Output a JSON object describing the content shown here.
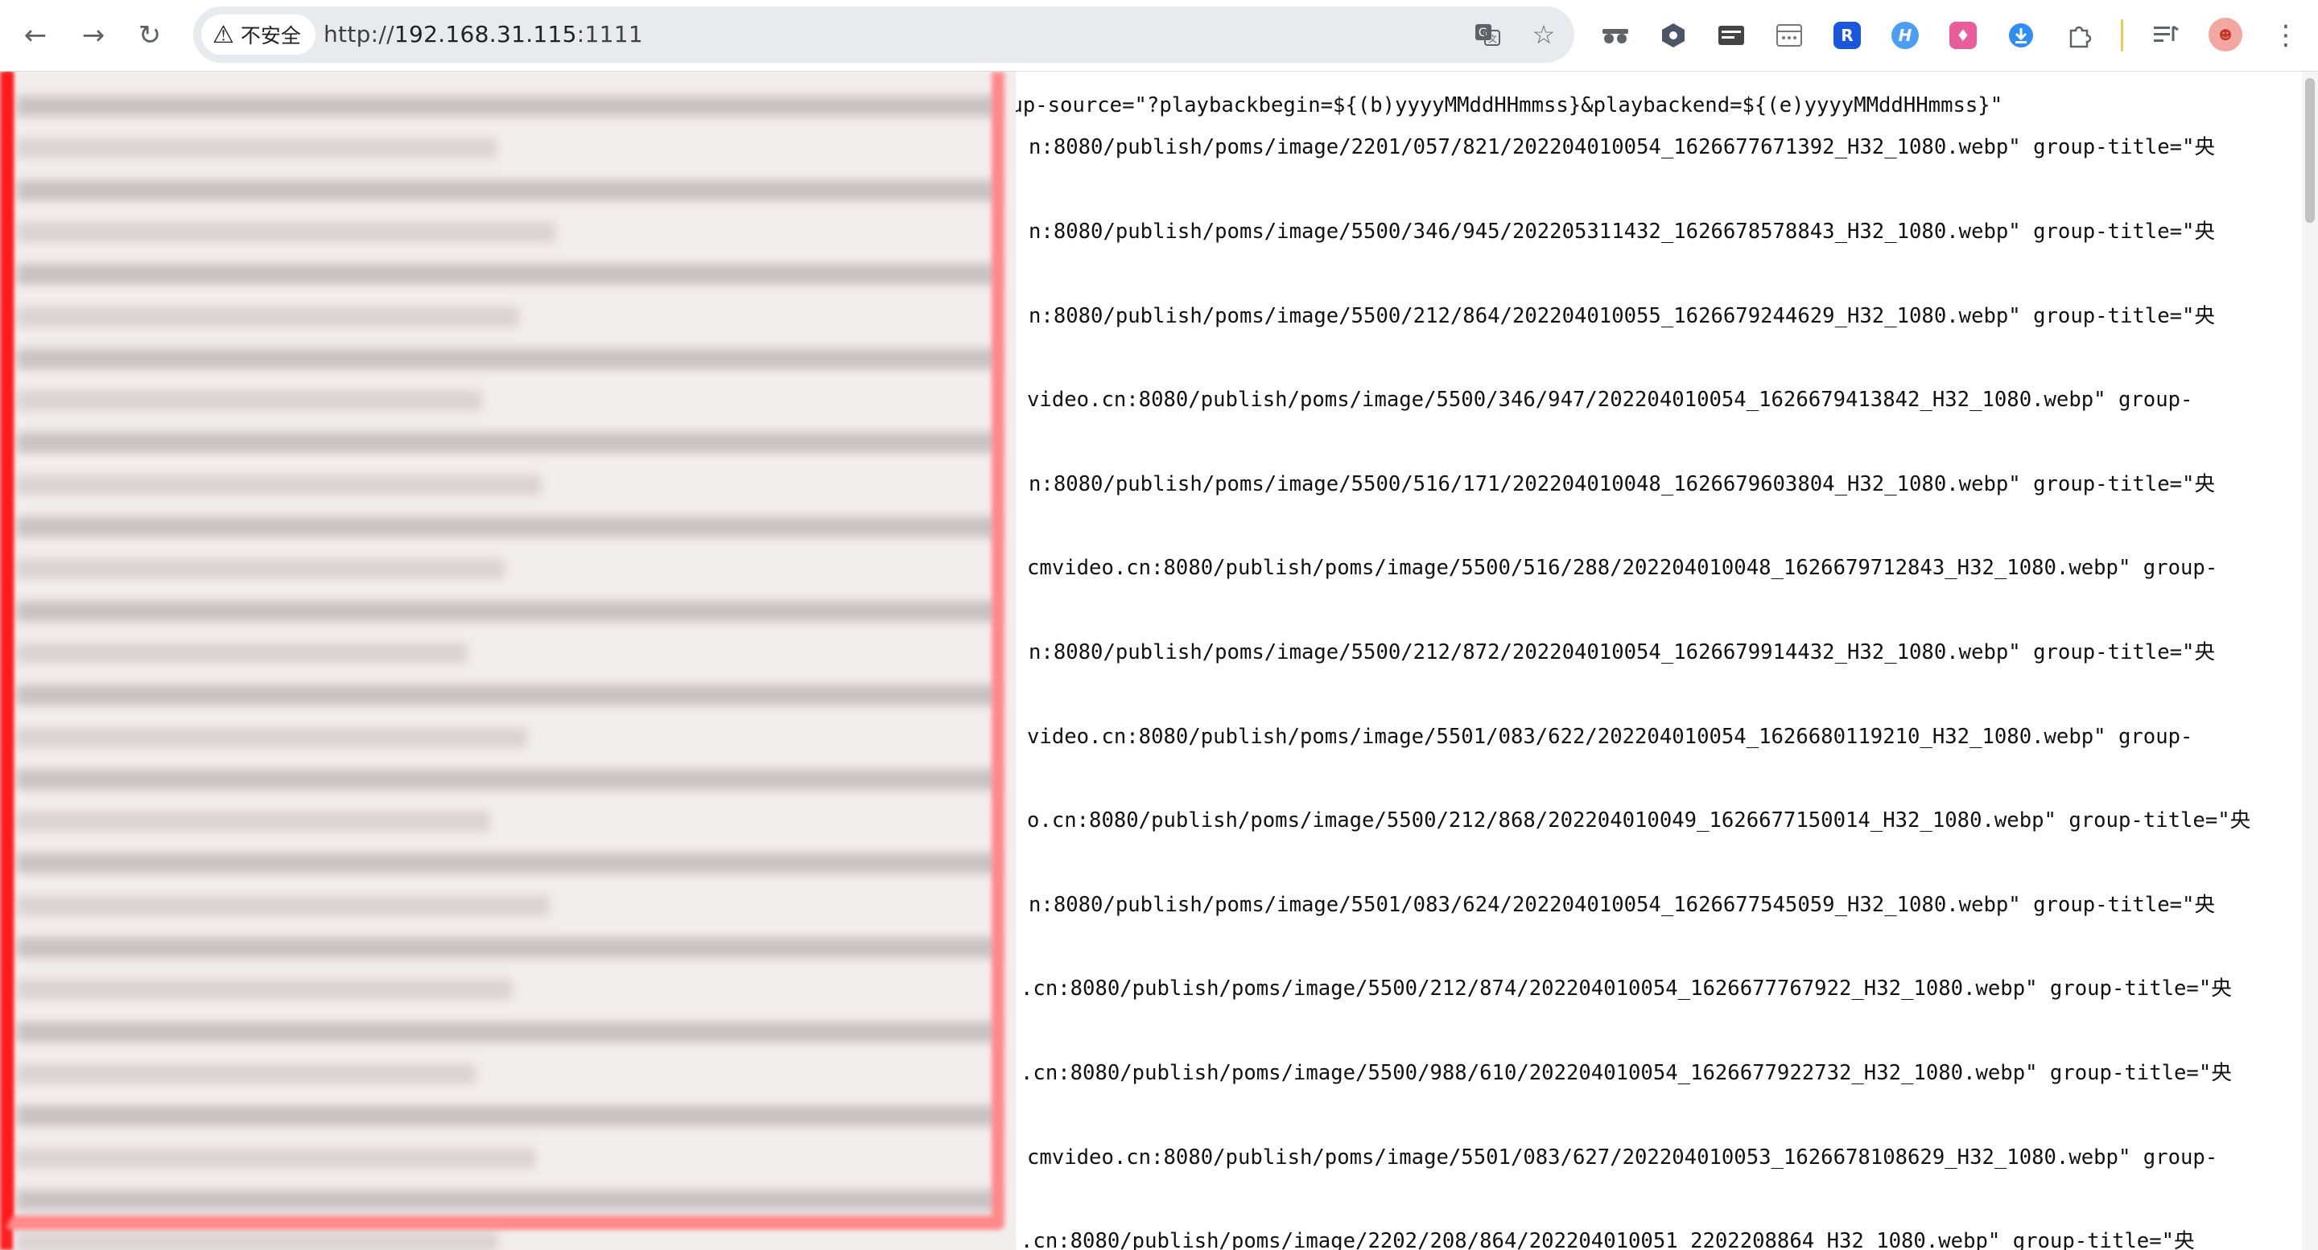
{
  "browser": {
    "security_label": "不安全",
    "url_scheme": "http://",
    "url_host": "192.168.31.115",
    "url_port": ":1111",
    "nav": {
      "back_icon": "back-arrow-icon",
      "forward_icon": "forward-arrow-icon",
      "reload_icon": "reload-icon"
    },
    "colors": {
      "divider": "#f2c94c",
      "avatar": "#f2a7a0"
    }
  },
  "content": {
    "lines": [
      {
        "text": "hup-source=\"?playbackbegin=${(b)yyyyMMddHHmmss}&playbackend=${(e)yyyyMMddHHmmss}\""
      },
      {
        "text": "n:8080/publish/poms/image/2201/057/821/202204010054_1626677671392_H32_1080.webp\" group-title=\"央"
      },
      {
        "text": ""
      },
      {
        "text": "n:8080/publish/poms/image/5500/346/945/202205311432_1626678578843_H32_1080.webp\" group-title=\"央"
      },
      {
        "text": ""
      },
      {
        "text": "n:8080/publish/poms/image/5500/212/864/202204010055_1626679244629_H32_1080.webp\" group-title=\"央"
      },
      {
        "text": ""
      },
      {
        "text": "video.cn:8080/publish/poms/image/5500/346/947/202204010054_1626679413842_H32_1080.webp\" group-"
      },
      {
        "text": ""
      },
      {
        "text": "n:8080/publish/poms/image/5500/516/171/202204010048_1626679603804_H32_1080.webp\" group-title=\"央"
      },
      {
        "text": ""
      },
      {
        "text": "cmvideo.cn:8080/publish/poms/image/5500/516/288/202204010048_1626679712843_H32_1080.webp\" group-"
      },
      {
        "text": ""
      },
      {
        "text": "n:8080/publish/poms/image/5500/212/872/202204010054_1626679914432_H32_1080.webp\" group-title=\"央"
      },
      {
        "text": ""
      },
      {
        "text": "video.cn:8080/publish/poms/image/5501/083/622/202204010054_1626680119210_H32_1080.webp\" group-"
      },
      {
        "text": ""
      },
      {
        "text": "o.cn:8080/publish/poms/image/5500/212/868/202204010049_1626677150014_H32_1080.webp\" group-title=\"央"
      },
      {
        "text": ""
      },
      {
        "text": "n:8080/publish/poms/image/5501/083/624/202204010054_1626677545059_H32_1080.webp\" group-title=\"央"
      },
      {
        "text": ""
      },
      {
        "text": ".cn:8080/publish/poms/image/5500/212/874/202204010054_1626677767922_H32_1080.webp\" group-title=\"央"
      },
      {
        "text": ""
      },
      {
        "text": ".cn:8080/publish/poms/image/5500/988/610/202204010054_1626677922732_H32_1080.webp\" group-title=\"央"
      },
      {
        "text": ""
      },
      {
        "text": "cmvideo.cn:8080/publish/poms/image/5501/083/627/202204010053_1626678108629_H32_1080.webp\" group-"
      },
      {
        "text": ""
      },
      {
        "text": ".cn:8080/publish/poms/image/2202/208/864/202204010051_2202208864_H32_1080.webp\" group-title=\"央"
      }
    ]
  },
  "redaction": {
    "border_color": "#ff1a1a",
    "note": ""
  }
}
